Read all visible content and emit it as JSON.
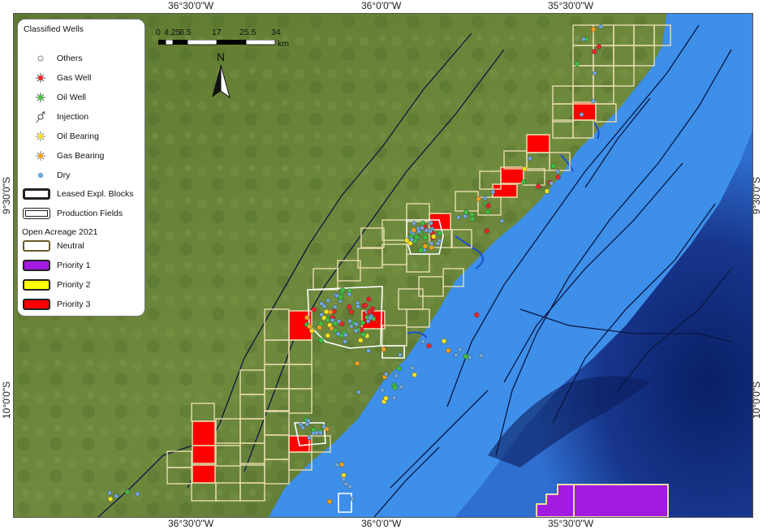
{
  "coords": {
    "top": [
      "36°30'0\"W",
      "36°0'0\"W",
      "35°30'0\"W"
    ],
    "bottom": [
      "36°30'0\"W",
      "36°0'0\"W",
      "35°30'0\"W"
    ],
    "left": [
      "9°30'0\"S",
      "10°0'0\"S"
    ],
    "right": [
      "9°30'0\"S",
      "10°0'0\"S"
    ]
  },
  "legend": {
    "title": "Classified Wells",
    "wells": [
      {
        "label": "Others",
        "icon": "open-circle-icon",
        "color": "#ffffff"
      },
      {
        "label": "Gas Well",
        "icon": "gas-well-icon",
        "color": "#e8262a"
      },
      {
        "label": "Oil Well",
        "icon": "oil-well-icon",
        "color": "#3fbf3f"
      },
      {
        "label": "Injection",
        "icon": "injection-icon",
        "color": "#ffffff"
      },
      {
        "label": "Oil Bearing",
        "icon": "oil-bearing-icon",
        "color": "#f2e21f"
      },
      {
        "label": "Gas Bearing",
        "icon": "gas-bearing-icon",
        "color": "#f0a020"
      },
      {
        "label": "Dry",
        "icon": "dry-circle-icon",
        "color": "#6fa8dc"
      }
    ],
    "blocks": [
      {
        "label": "Leased Expl. Blocks",
        "color": "#ffffff"
      },
      {
        "label": "Production Fields",
        "color": "#ffffff"
      }
    ],
    "acreage_title": "Open Acreage 2021",
    "acreage": [
      {
        "label": "Neutral",
        "color": "#ffffff"
      },
      {
        "label": "Priority 1",
        "color": "#a31be0"
      },
      {
        "label": "Priority 2",
        "color": "#ffff00"
      },
      {
        "label": "Priority 3",
        "color": "#ff0000"
      }
    ]
  },
  "scalebar": {
    "ticks": [
      "0",
      "4.25",
      "8.5",
      "17",
      "25.5",
      "34"
    ],
    "unit": "km"
  },
  "north_label": "N",
  "colors": {
    "land": "#5f7a33",
    "sea_shallow": "#3c8ee8",
    "sea_deep": "#0f2a7a",
    "block_outline": "#e8dcae",
    "priority3": "#ff0000",
    "priority1": "#a31be0"
  }
}
